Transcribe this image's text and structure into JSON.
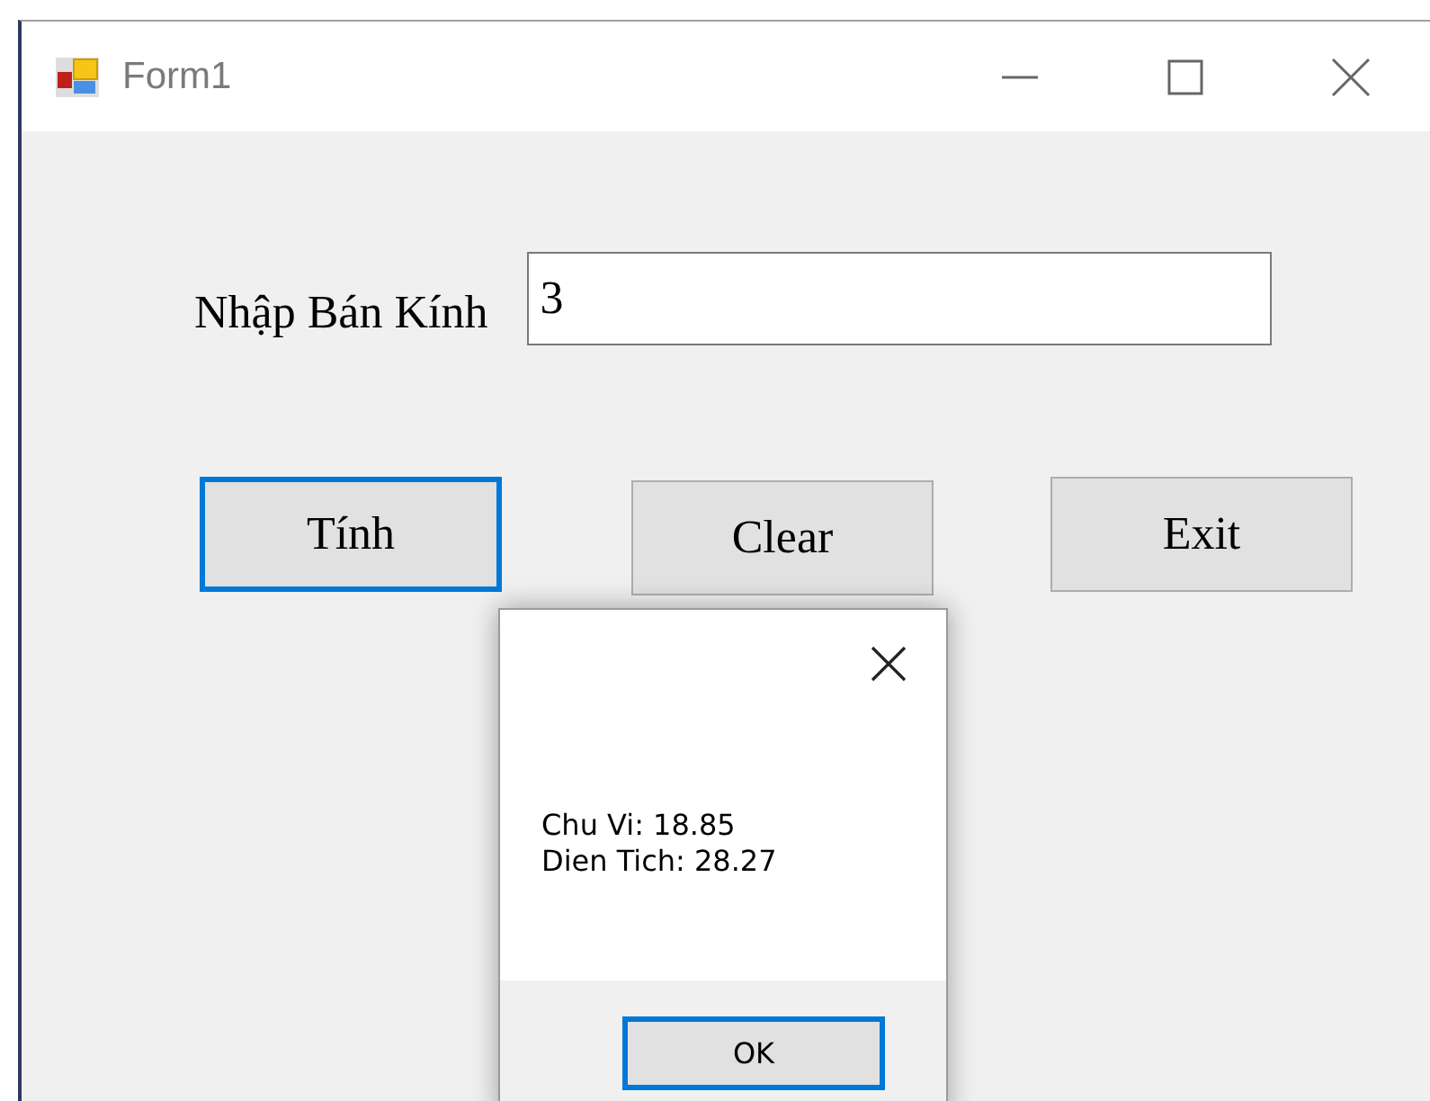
{
  "window": {
    "title": "Form1"
  },
  "form": {
    "label": "Nhập Bán Kính",
    "input": {
      "value": "3"
    },
    "buttons": [
      {
        "label": "Tính",
        "focused": true
      },
      {
        "label": "Clear",
        "focused": false
      },
      {
        "label": "Exit",
        "focused": false
      }
    ]
  },
  "message_box": {
    "lines": [
      "Chu Vi: 18.85",
      "Dien Tich: 28.27"
    ],
    "button": {
      "label": "OK",
      "focused": true
    }
  }
}
